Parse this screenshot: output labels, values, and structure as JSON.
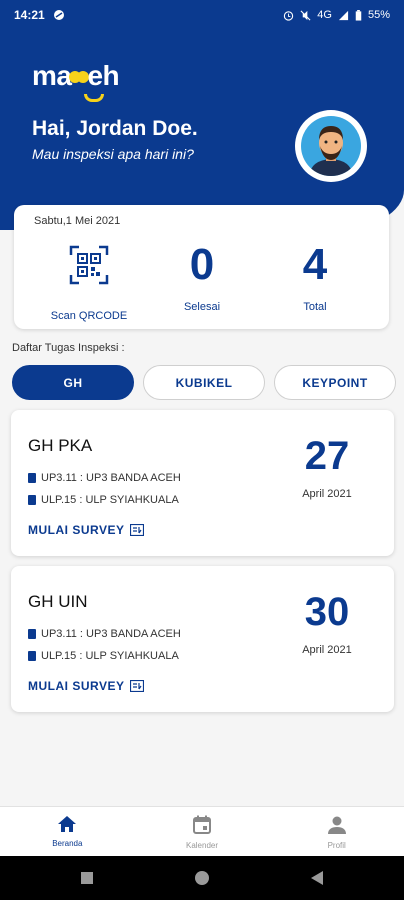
{
  "status_bar": {
    "time": "14:21",
    "network": "4G",
    "battery": "55%"
  },
  "header": {
    "logo_text_1": "ma",
    "logo_text_2": "eh",
    "greeting": "Hai, Jordan Doe.",
    "subtitle": "Mau inspeksi apa hari ini?"
  },
  "summary": {
    "date": "Sabtu,1 Mei 2021",
    "scan_label": "Scan QRCODE",
    "done_value": "0",
    "done_label": "Selesai",
    "total_value": "4",
    "total_label": "Total"
  },
  "list_title": "Daftar Tugas Inspeksi :",
  "tabs": [
    {
      "label": "GH",
      "active": true
    },
    {
      "label": "KUBIKEL",
      "active": false
    },
    {
      "label": "KEYPOINT",
      "active": false
    }
  ],
  "tasks": [
    {
      "name": "GH PKA",
      "up": "UP3.11 : UP3 BANDA ACEH",
      "ulp": "ULP.15 : ULP SYIAHKUALA",
      "action": "MULAI SURVEY",
      "day": "27",
      "month": "April 2021"
    },
    {
      "name": "GH UIN",
      "up": "UP3.11 : UP3 BANDA ACEH",
      "ulp": "ULP.15 : ULP SYIAHKUALA",
      "action": "MULAI SURVEY",
      "day": "30",
      "month": "April 2021"
    }
  ],
  "bottom_nav": [
    {
      "label": "Beranda",
      "icon": "home-icon",
      "active": true
    },
    {
      "label": "Kalender",
      "icon": "calendar-icon",
      "active": false
    },
    {
      "label": "Profil",
      "icon": "person-icon",
      "active": false
    }
  ],
  "colors": {
    "primary": "#0b3a8f",
    "accent": "#f7d21a"
  }
}
